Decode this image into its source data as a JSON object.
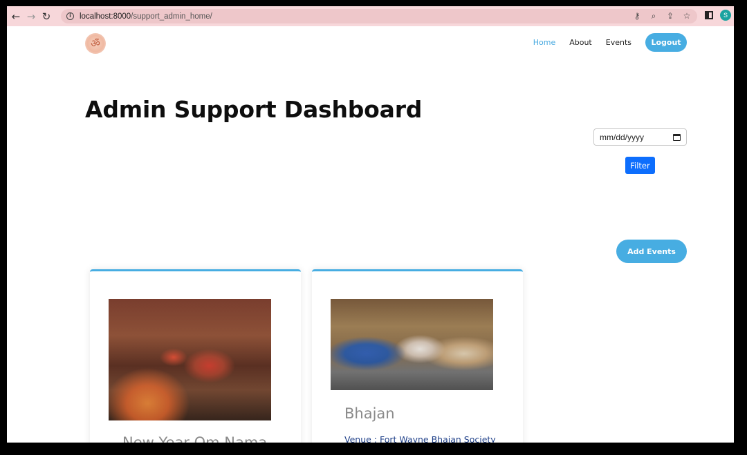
{
  "browser": {
    "url_host": "localhost:8000",
    "url_path": "/support_admin_home/",
    "profile_initial": "S"
  },
  "nav": {
    "items": [
      {
        "label": "Home",
        "active": true
      },
      {
        "label": "About",
        "active": false
      },
      {
        "label": "Events",
        "active": false
      }
    ],
    "logout_label": "Logout"
  },
  "main": {
    "title": "Admin Support Dashboard",
    "date_placeholder": "mm/dd/yyyy",
    "filter_label": "Filter",
    "add_events_label": "Add Events"
  },
  "events": [
    {
      "title": "New Year Om Nama",
      "image": "temple-puja-photo"
    },
    {
      "title": "Bhajan",
      "venue": "Venue : Fort Wayne Bhajan Society",
      "image": "bhajan-musicians-photo"
    }
  ],
  "colors": {
    "accent": "#47ade2",
    "filter_button": "#0d6efd",
    "venue_text": "#1e3f88"
  }
}
